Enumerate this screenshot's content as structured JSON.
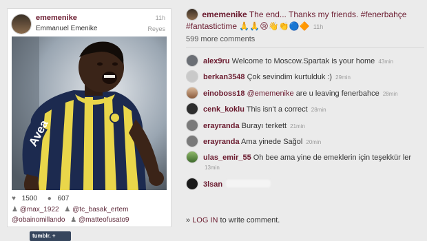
{
  "post": {
    "username": "ememenike",
    "full_name": "Emmanuel Emenike",
    "time": "11h",
    "location": "Reyes",
    "likes_label": "1500",
    "comments_count_label": "607",
    "tags": [
      "@max_1922",
      "@tc_basak_ertem",
      "@obainomillando",
      "@matteofusato9"
    ],
    "jersey_sponsor": "Avea"
  },
  "caption": {
    "username": "ememenike",
    "text": "The end... Thanks my friends. #fenerbahçe #fantastictime",
    "emoji": "🙏🙏😢👋👏🔵🔶",
    "time": "11h"
  },
  "more_comments": "599 more comments",
  "comments": [
    {
      "user": "alex9ru",
      "text": "Welcome to Moscow.Spartak is your home",
      "time": "43min"
    },
    {
      "user": "berkan3548",
      "text": "Çok sevindim kurtulduk :)",
      "time": "29min"
    },
    {
      "user": "einoboss18",
      "mention": "@ememenike",
      "text": "are u leaving fenerbahce",
      "time": "28min"
    },
    {
      "user": "cenk_koklu",
      "text": "This isn't a correct",
      "time": "28min"
    },
    {
      "user": "erayranda",
      "text": "Burayı terkett",
      "time": "21min"
    },
    {
      "user": "erayranda",
      "text": "Ama yinede Sağol",
      "time": "20min"
    },
    {
      "user": "ulas_emir_55",
      "text": "Oh bee ama yine de emeklerin için teşekkür ler",
      "time": "13min"
    },
    {
      "user": "3lsan",
      "text": "",
      "time": ""
    }
  ],
  "login": {
    "prefix": "»",
    "link": "LOG IN",
    "suffix": "to write comment."
  },
  "tumblr_label": "tumblr. +",
  "colors": {
    "accent": "#6b1b2f",
    "background": "#ebebeb",
    "jersey_navy": "#1c2a4f",
    "jersey_yellow": "#e9d64a"
  }
}
